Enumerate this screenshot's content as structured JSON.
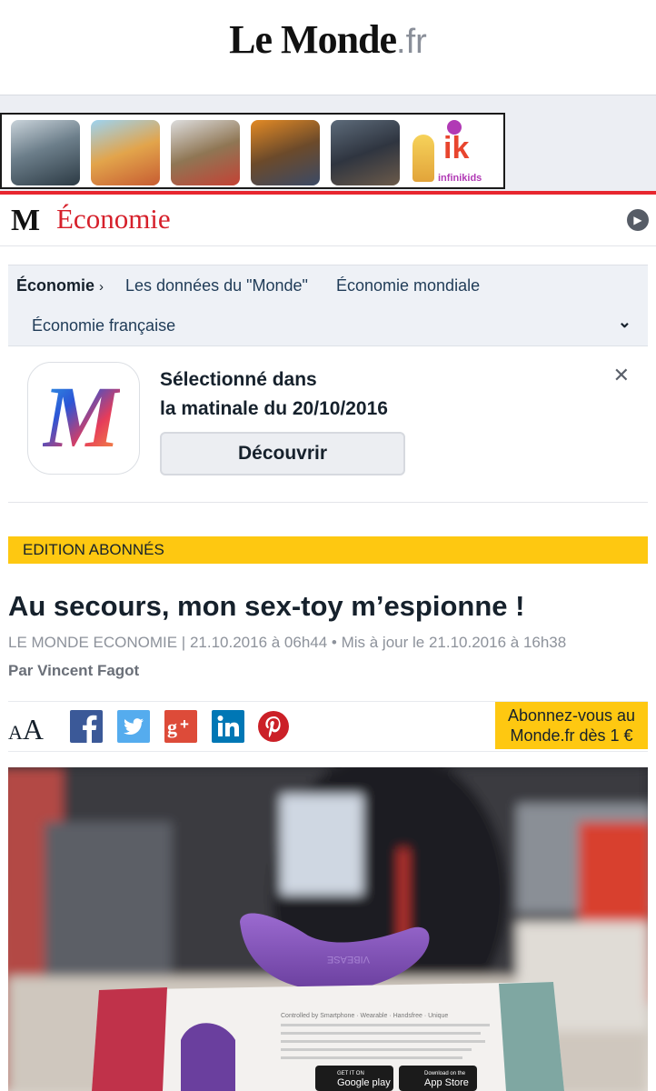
{
  "site": {
    "logo_main": "Le Monde",
    "logo_tld": ".fr"
  },
  "ad": {
    "brand_letters": "ik",
    "brand_name": "infinikids"
  },
  "section": {
    "name": "Économie",
    "logo_letter": "M"
  },
  "subnav": {
    "items": [
      {
        "label": "Économie",
        "current": true
      },
      {
        "label": "Les données du \"Monde\"",
        "current": false
      },
      {
        "label": "Économie mondiale",
        "current": false
      },
      {
        "label": "Économie française",
        "current": false
      }
    ],
    "current_separator": "›"
  },
  "promo": {
    "title": "Sélectionné dans\nla matinale du 20/10/2016",
    "button_label": "Découvrir",
    "close_label": "✕",
    "app_icon_letter": "M"
  },
  "edition_label": "EDITION ABONNÉS",
  "article": {
    "headline": "Au secours, mon sex-toy m’espionne !",
    "meta": "LE MONDE ECONOMIE | 21.10.2016 à 06h44 • Mis à jour le 21.10.2016 à 16h38",
    "byline": "Par Vincent Fagot"
  },
  "share": {
    "font_small": "A",
    "font_big": "A",
    "networks": [
      "facebook",
      "twitter",
      "google-plus",
      "linkedin",
      "pinterest"
    ],
    "subscribe_label": "Abonnez-vous au\nMonde.fr dès 1 €"
  },
  "photo": {
    "product_label": "VIBEASE",
    "box_text": "Controlled by Smartphone · Wearable · Handsfree · Unique",
    "store_google_small": "GET IT ON",
    "store_google": "Google play",
    "store_apple_small": "Download on the",
    "store_apple": "App Store"
  },
  "colors": {
    "accent_red": "#e7262f",
    "section_red": "#d6202b",
    "edition_yellow": "#fec811",
    "facebook": "#3b5998",
    "twitter": "#55acee",
    "google_plus": "#dd4b39",
    "linkedin": "#0077b5",
    "pinterest": "#cb2027",
    "toy_purple": "#8354b8"
  }
}
